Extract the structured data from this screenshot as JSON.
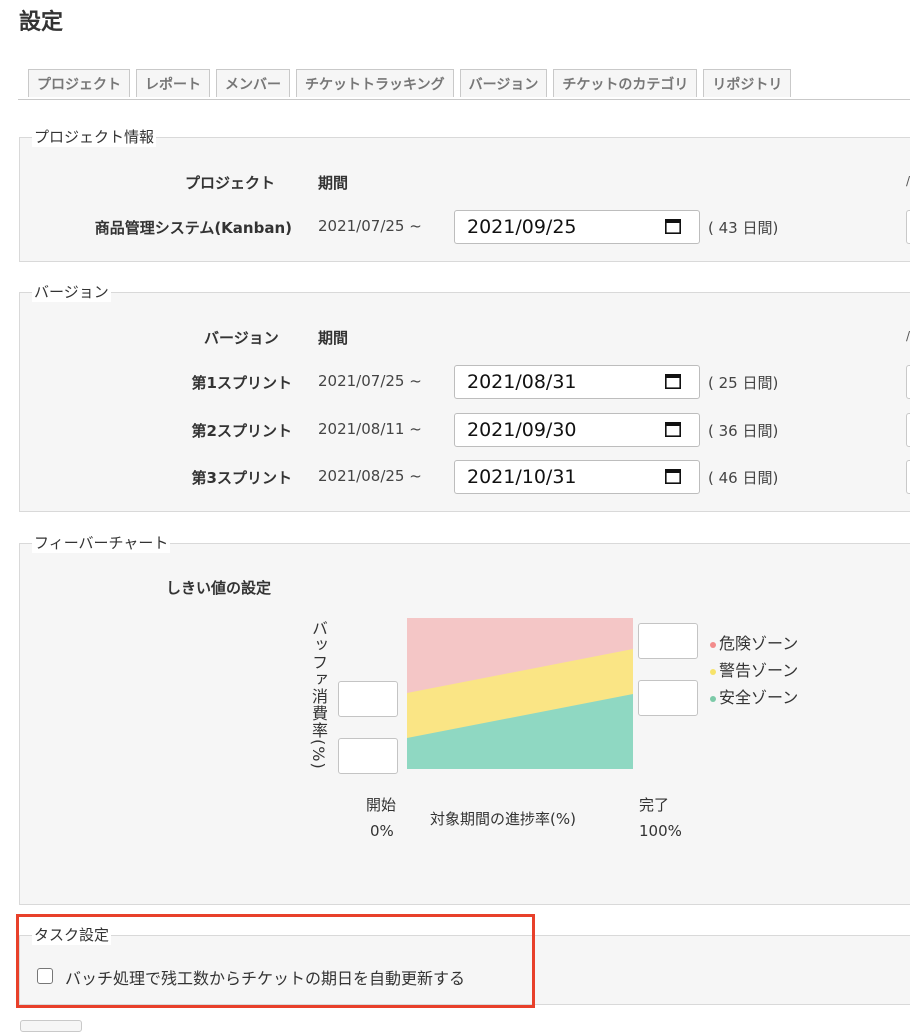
{
  "page": {
    "title": "設定"
  },
  "tabs": [
    "プロジェクト",
    "レポート",
    "メンバー",
    "チケットトラッキング",
    "バージョン",
    "チケットのカテゴリ",
    "リポジトリ"
  ],
  "project_info": {
    "legend": "プロジェクト情報",
    "col_project": "プロジェクト",
    "col_period": "期間",
    "row": {
      "name": "商品管理システム(Kanban)",
      "start": "2021/07/25 ~",
      "end": "2021/09/25",
      "days": "( 43 日間)"
    }
  },
  "version": {
    "legend": "バージョン",
    "col_version": "バージョン",
    "col_period": "期間",
    "rows": [
      {
        "name": "第1スプリント",
        "start": "2021/07/25 ~",
        "end": "2021/08/31",
        "days": "( 25 日間)"
      },
      {
        "name": "第2スプリント",
        "start": "2021/08/11 ~",
        "end": "2021/09/30",
        "days": "( 36 日間)"
      },
      {
        "name": "第3スプリント",
        "start": "2021/08/25 ~",
        "end": "2021/10/31",
        "days": "( 46 日間)"
      }
    ]
  },
  "fever": {
    "legend": "フィーバーチャート",
    "threshold_title": "しきい値の設定",
    "y_label": "バッファ消費率(%)",
    "x_label": "対象期間の進捗率(%)",
    "x_start_label": "開始",
    "x_start_value": "0%",
    "x_end_label": "完了",
    "x_end_value": "100%",
    "legend_items": [
      {
        "label": "危険ゾーン",
        "color": "#f28b8b"
      },
      {
        "label": "警告ゾーン",
        "color": "#f7e36a"
      },
      {
        "label": "安全ゾーン",
        "color": "#7ccaa8"
      }
    ],
    "zone_colors": {
      "danger": "#f4c6c6",
      "warning": "#fae585",
      "safe": "#8fd8c2"
    }
  },
  "task": {
    "legend": "タスク設定",
    "checkbox_label": "バッチ処理で残工数からチケットの期日を自動更新する",
    "checked": false
  },
  "icons": {
    "calendar": "calendar-icon"
  }
}
